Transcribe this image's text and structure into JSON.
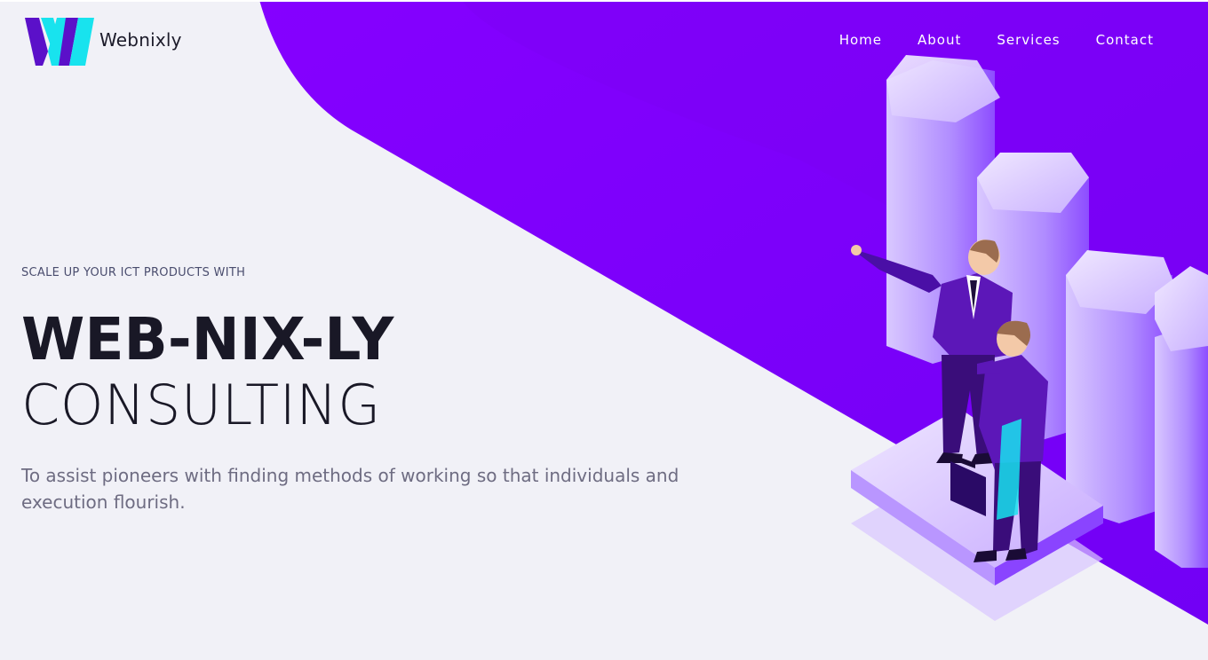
{
  "brand": {
    "name": "Webnixly",
    "logo_icon": "w-logo-icon",
    "colors": {
      "primary": "#5a0fc8",
      "accent": "#18e3ee"
    }
  },
  "nav": {
    "items": [
      {
        "label": "Home"
      },
      {
        "label": "About"
      },
      {
        "label": "Services"
      },
      {
        "label": "Contact"
      }
    ]
  },
  "hero": {
    "eyebrow": "SCALE UP YOUR ICT PRODUCTS WITH",
    "title_line1": "WEB-NIX-LY",
    "title_line2": "CONSULTING",
    "description": "To assist pioneers with finding methods of working so that individuals and execution flourish.",
    "illustration": "businessmen-pointing-at-bar-chart-illustration"
  },
  "theme": {
    "background": "#f1f1f7",
    "purple": "#7b00ff",
    "heading_color": "#191826",
    "text_color": "#6e6c82"
  }
}
